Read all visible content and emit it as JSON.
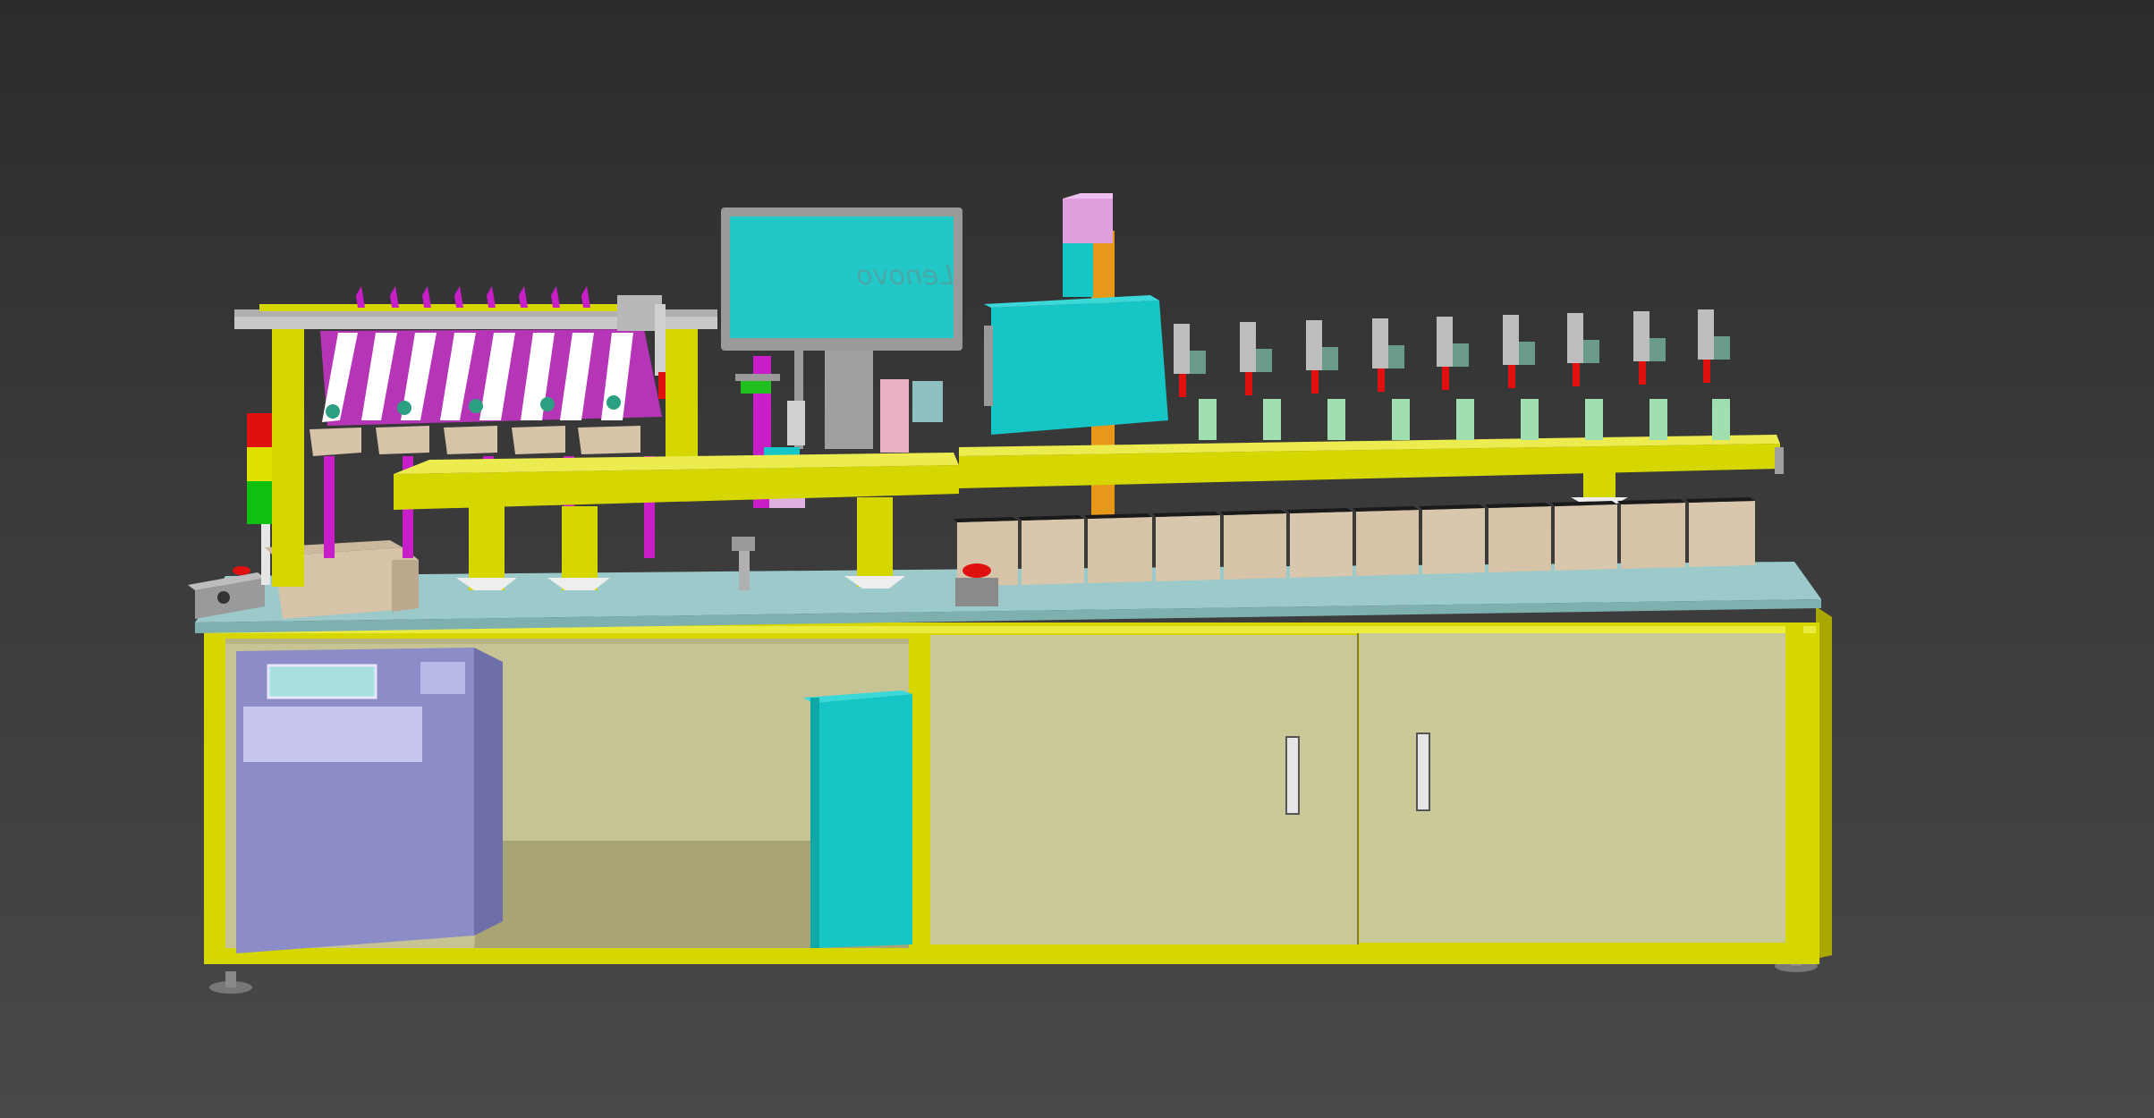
{
  "viewport": {
    "background": "#3c3c3c",
    "name": "3d-viewport"
  },
  "machine": {
    "description_visible_text": "",
    "monitor_logo": "Lenovo",
    "colors": {
      "frame": "#d6d600",
      "tabletop": "#9cc9c9",
      "cabinet_panel": "#c8c897",
      "teal_block": "#16c6c6",
      "control_panel": "#8c8cc8",
      "magenta_rails": "#c81ec8",
      "carton": "#d6c3a8",
      "signal_red": "#e01010",
      "signal_yellow": "#e0e000",
      "signal_green": "#10c010",
      "pink_column_top": "#e0a0e0",
      "orange_column": "#e89818"
    },
    "carton_count": 12,
    "screwdriver_count": 9,
    "feed_chute_count": 10
  }
}
